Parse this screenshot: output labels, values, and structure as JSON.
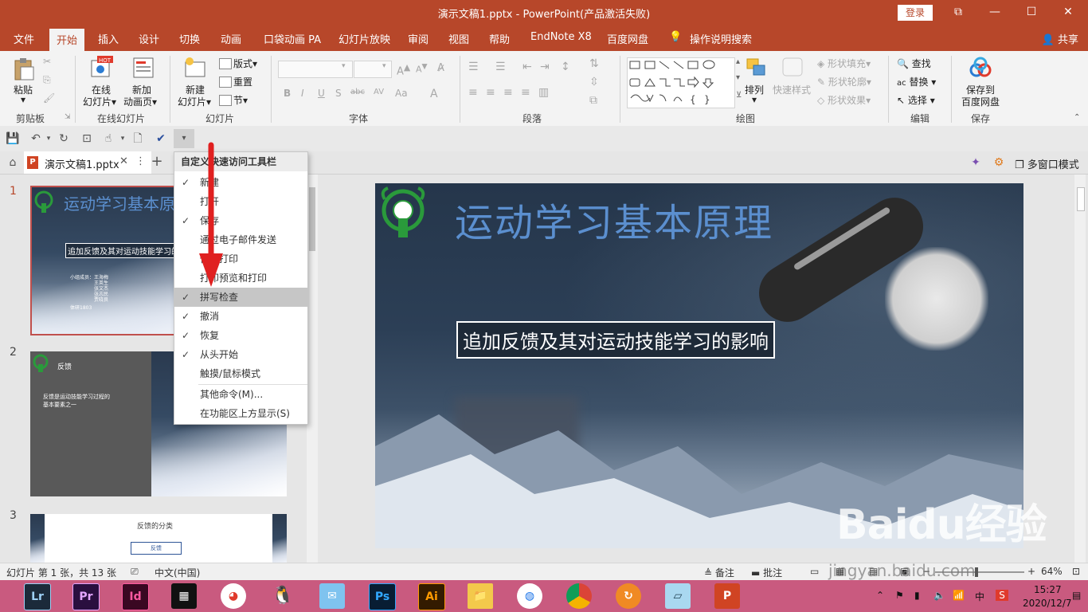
{
  "window": {
    "title": "演示文稿1.pptx  -  PowerPoint(产品激活失败)",
    "login_label": "登录",
    "controls": {
      "restore_icon": "⧉",
      "minimize": "—",
      "maximize": "☐",
      "close": "✕"
    }
  },
  "ribbon_tabs": [
    "文件",
    "开始",
    "插入",
    "设计",
    "切换",
    "动画",
    "口袋动画 PA",
    "幻灯片放映",
    "审阅",
    "视图",
    "帮助",
    "EndNote X8",
    "百度网盘",
    "操作说明搜索"
  ],
  "share_label": "共享",
  "ribbon": {
    "clipboard": {
      "paste": "粘贴",
      "group": "剪贴板"
    },
    "online_slides": {
      "online": "在线",
      "online2": "幻灯片",
      "new_anim": "新加",
      "new_anim2": "动画页",
      "group": "在线幻灯片"
    },
    "slides": {
      "new": "新建",
      "new2": "幻灯片",
      "layout": "版式",
      "reset": "重置",
      "section": "节",
      "group": "幻灯片"
    },
    "font": {
      "group": "字体",
      "bold": "B",
      "italic": "I",
      "underline": "U",
      "shadow": "S",
      "strike": "abc",
      "spacing": "AV",
      "case": "Aa",
      "color": "A"
    },
    "paragraph": {
      "group": "段落"
    },
    "drawing": {
      "arrange": "排列",
      "quick_styles": "快速样式",
      "fill": "形状填充",
      "outline": "形状轮廓",
      "effects": "形状效果",
      "group": "绘图"
    },
    "editing": {
      "find": "查找",
      "replace": "替换",
      "select": "选择",
      "group": "编辑"
    },
    "save": {
      "label1": "保存到",
      "label2": "百度网盘",
      "group": "保存"
    }
  },
  "doc_tab": {
    "label": "演示文稿1.pptx",
    "right_label": "多窗口模式"
  },
  "qat_menu": {
    "header": "自定义快速访问工具栏",
    "items": [
      {
        "label": "新建",
        "checked": true
      },
      {
        "label": "打开",
        "checked": false
      },
      {
        "label": "保存",
        "checked": true
      },
      {
        "label": "通过电子邮件发送",
        "checked": false
      },
      {
        "label": "快速打印",
        "checked": false
      },
      {
        "label": "打印预览和打印",
        "checked": false
      },
      {
        "label": "拼写检查",
        "checked": true
      },
      {
        "label": "撤消",
        "checked": true
      },
      {
        "label": "恢复",
        "checked": true
      },
      {
        "label": "从头开始",
        "checked": true
      },
      {
        "label": "触摸/鼠标模式",
        "checked": false
      },
      {
        "label": "其他命令(M)...",
        "checked": false
      },
      {
        "label": "在功能区上方显示(S)",
        "checked": false
      }
    ]
  },
  "thumbnails": [
    {
      "num": "1",
      "title": "运动学习基本原理",
      "subtitle": "追加反馈及其对运动技能学习的影响",
      "members": [
        "小组成员：王海梅",
        "王英生",
        "张文杰",
        "张志民",
        "贾晓良"
      ],
      "class": "体研1803"
    },
    {
      "num": "2",
      "title": "反馈",
      "body": "反馈是运动技能学习过程的基本要素之一"
    },
    {
      "num": "3",
      "title": "反馈的分类",
      "box": "反馈"
    }
  ],
  "slide": {
    "title": "运动学习基本原理",
    "subtitle": "追加反馈及其对运动技能学习的影响"
  },
  "status": {
    "slide_info": "幻灯片 第 1 张，共 13 张",
    "language": "中文(中国)",
    "notes": "备注",
    "comments": "批注",
    "zoom": "64%"
  },
  "taskbar": {
    "apps": [
      {
        "name": "Lr",
        "bg": "#1b2a3a",
        "fg": "#9dd0f5"
      },
      {
        "name": "Pr",
        "bg": "#2a0f3f",
        "fg": "#e3a5ff"
      },
      {
        "name": "Id",
        "bg": "#3a0822",
        "fg": "#ff5aa0"
      },
      {
        "name": "Ps",
        "bg": "#081d33",
        "fg": "#31a8ff"
      },
      {
        "name": "Ai",
        "bg": "#331b00",
        "fg": "#ff9a00"
      }
    ],
    "time": "15:27",
    "date": "2020/12/7",
    "ime": "中"
  },
  "watermark": {
    "brand": "Baidu经验",
    "url": "jingyan.baidu.com"
  },
  "colors": {
    "accent": "#b7472a",
    "taskbar": "#c95a7f",
    "arrow": "#e02020"
  }
}
